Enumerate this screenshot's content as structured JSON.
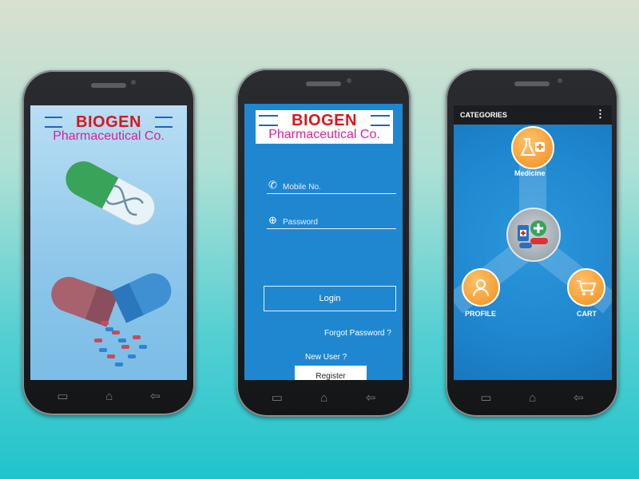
{
  "brand": {
    "name": "BIOGEN",
    "company": "Pharmaceutical Co."
  },
  "login": {
    "mobile_placeholder": "Mobile No.",
    "password_placeholder": "Password",
    "login_label": "Login",
    "forgot_label": "Forgot Password ?",
    "new_user_label": "New User ?",
    "register_label": "Register"
  },
  "categories": {
    "title": "CATEGORIES",
    "menu_icon": "⋮",
    "items": [
      {
        "label": "Medicine",
        "icon": "flask-plus-icon"
      },
      {
        "label": "PROFILE",
        "icon": "user-icon"
      },
      {
        "label": "CART",
        "icon": "cart-icon"
      }
    ]
  },
  "nav": {
    "back": "⇦",
    "home": "⌂",
    "recent": "▭"
  },
  "colors": {
    "screen_blue": "#1f87cf",
    "splash_blue": "#9fd1ef",
    "orange": "#f39a2b",
    "logo_red": "#d7171f",
    "logo_pink": "#d6229c"
  }
}
